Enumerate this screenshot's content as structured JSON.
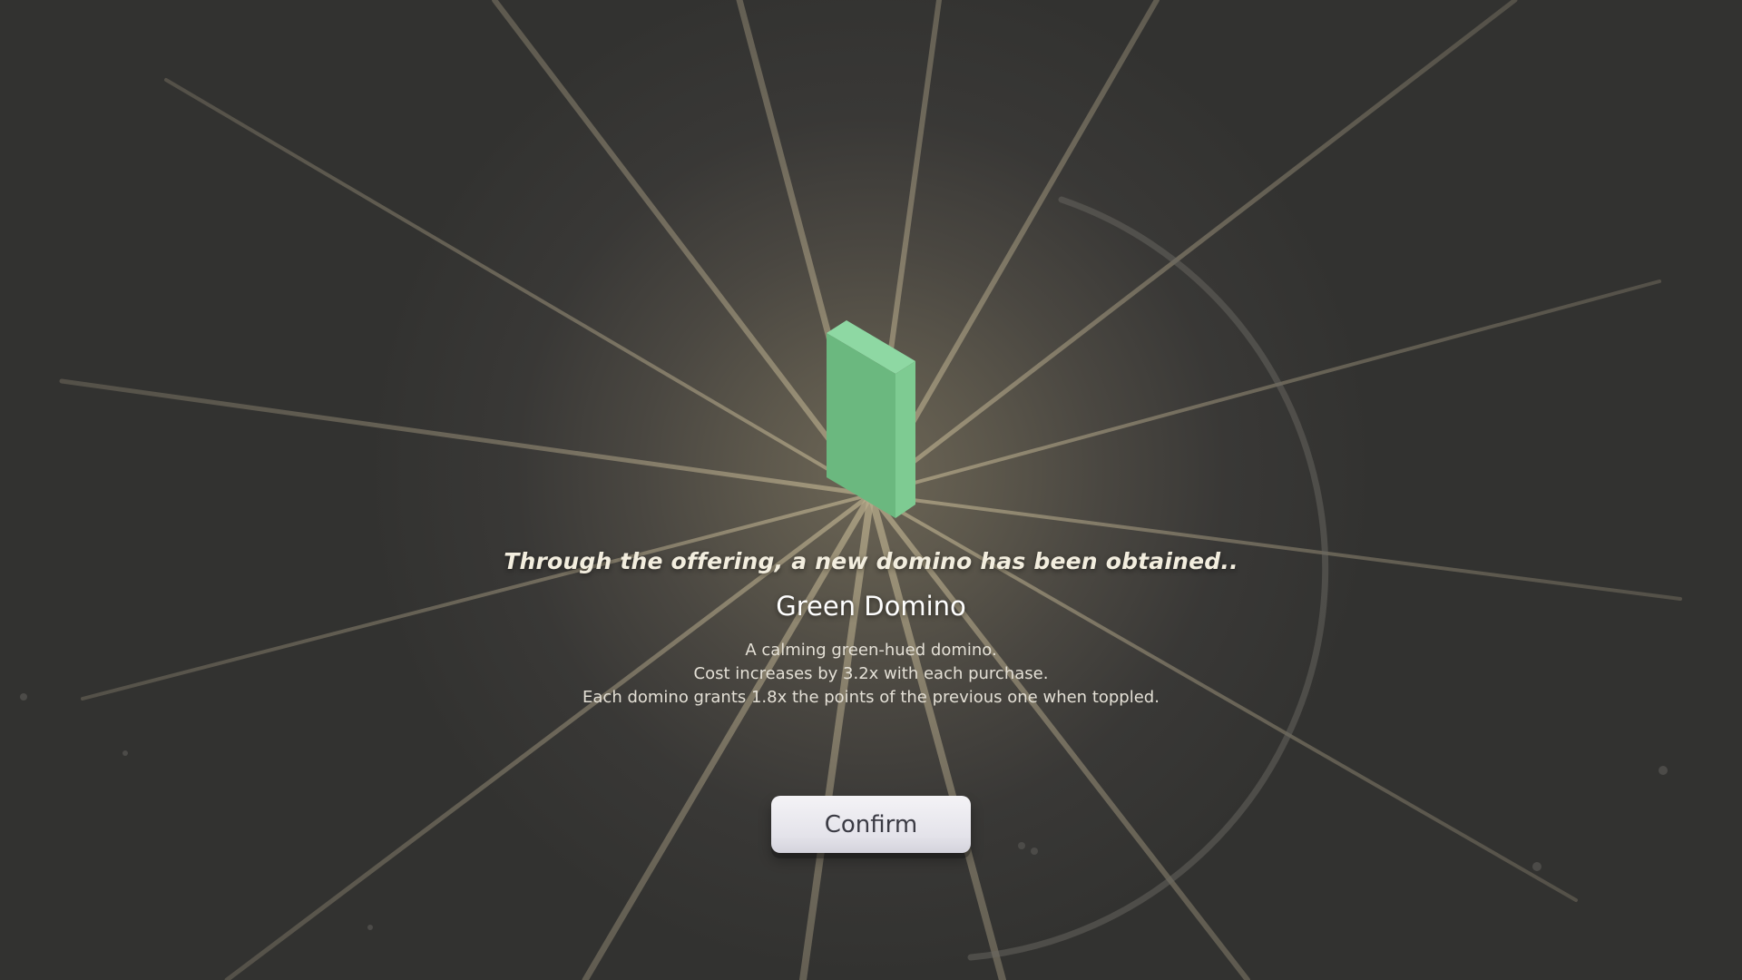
{
  "reward": {
    "headline": "Through the offering, a new domino has been obtained..",
    "item_name": "Green Domino",
    "description_lines": [
      "A calming green-hued domino.",
      "Cost increases by 3.2x with each purchase.",
      "Each domino grants 1.8x the points of the previous one when toppled."
    ],
    "item_icon": "green-domino-icon"
  },
  "confirm_label": "Confirm",
  "colors": {
    "background": "#323230",
    "glow": "#6d6656",
    "rays": "#8a8169",
    "domino_front": "#6bb87f",
    "domino_side": "#7ecb92",
    "domino_top": "#8ed8a3",
    "button": "#ecebf0",
    "button_text": "#3b3b44"
  }
}
